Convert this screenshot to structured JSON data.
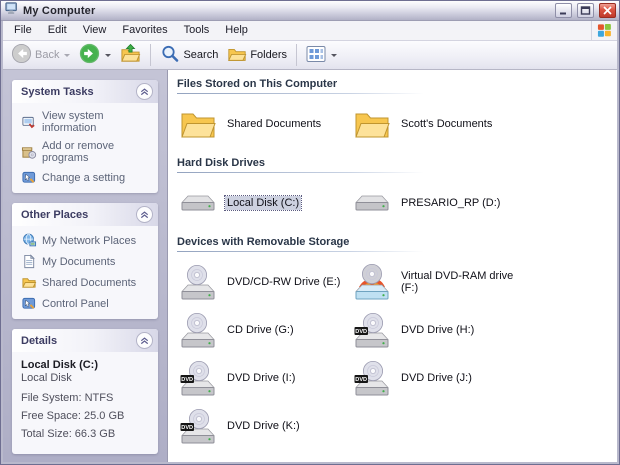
{
  "window": {
    "title": "My Computer",
    "icon": "computer-icon",
    "controls": [
      "minimize",
      "maximize",
      "close"
    ]
  },
  "menu": {
    "items": [
      "File",
      "Edit",
      "View",
      "Favorites",
      "Tools",
      "Help"
    ],
    "logo": "windows-logo-icon"
  },
  "toolbar": {
    "back": {
      "label": "Back",
      "disabled": true,
      "icon": "back-icon"
    },
    "forward": {
      "icon": "forward-icon"
    },
    "up": {
      "icon": "up-folder-icon"
    },
    "search": {
      "label": "Search",
      "icon": "search-icon"
    },
    "folders": {
      "label": "Folders",
      "icon": "folders-icon"
    },
    "views": {
      "icon": "views-icon"
    }
  },
  "sidebar": {
    "panels": [
      {
        "title": "System Tasks",
        "type": "links",
        "items": [
          {
            "label": "View system information",
            "icon": "system-information"
          },
          {
            "label": "Add or remove programs",
            "icon": "add-remove-programs"
          },
          {
            "label": "Change a setting",
            "icon": "change-setting"
          }
        ]
      },
      {
        "title": "Other Places",
        "type": "links",
        "items": [
          {
            "label": "My Network Places",
            "icon": "network-places"
          },
          {
            "label": "My Documents",
            "icon": "my-documents"
          },
          {
            "label": "Shared Documents",
            "icon": "shared-documents"
          },
          {
            "label": "Control Panel",
            "icon": "control-panel"
          }
        ]
      },
      {
        "title": "Details",
        "type": "details",
        "heading": "Local Disk (C:)",
        "subheading": "Local Disk",
        "rows": [
          "File System: NTFS",
          "Free Space: 25.0 GB",
          "Total Size: 66.3 GB"
        ]
      }
    ]
  },
  "main": {
    "sections": [
      {
        "header": "Files Stored on This Computer",
        "items": [
          {
            "label": "Shared Documents",
            "icon": "folder"
          },
          {
            "label": "Scott's Documents",
            "icon": "folder"
          }
        ]
      },
      {
        "header": "Hard Disk Drives",
        "items": [
          {
            "label": "Local Disk (C:)",
            "icon": "hdd",
            "selected": true
          },
          {
            "label": "PRESARIO_RP (D:)",
            "icon": "hdd"
          }
        ]
      },
      {
        "header": "Devices with Removable Storage",
        "items": [
          {
            "label": "DVD/CD-RW Drive (E:)",
            "icon": "cd-drive"
          },
          {
            "label": "Virtual DVD-RAM drive (F:)",
            "icon": "dvd-ram"
          },
          {
            "label": "CD Drive (G:)",
            "icon": "cd-drive"
          },
          {
            "label": "DVD Drive (H:)",
            "icon": "dvd-drive"
          },
          {
            "label": "DVD Drive (I:)",
            "icon": "dvd-drive"
          },
          {
            "label": "DVD Drive (J:)",
            "icon": "dvd-drive"
          },
          {
            "label": "DVD Drive (K:)",
            "icon": "dvd-drive"
          }
        ]
      }
    ],
    "dvd_badge": "DVD"
  },
  "colors": {
    "selection_bg": "#cdd1e0",
    "sidebar_bg": "#b2b2c8",
    "titlebar": "#c7c7d8",
    "close_button": "#da5240",
    "link_text": "#5c6478",
    "folder_yellow": "#f7c64f"
  }
}
